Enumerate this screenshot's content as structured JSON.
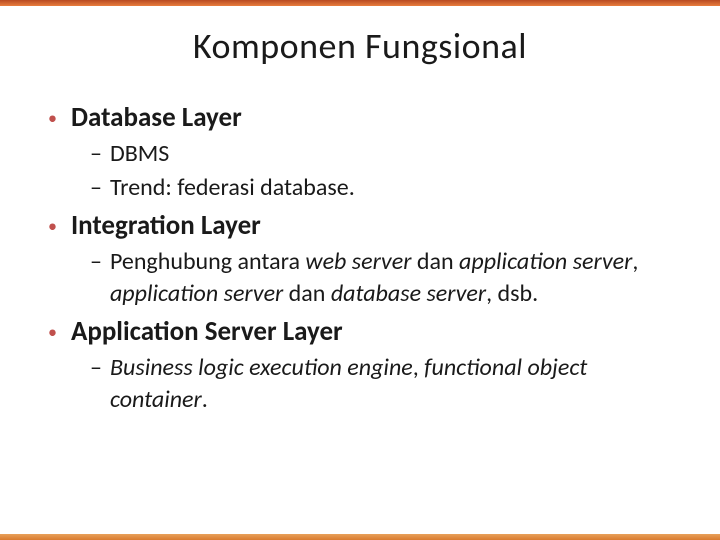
{
  "title": "Komponen Fungsional",
  "items": [
    {
      "label": "Database Layer",
      "sub": [
        {
          "runs": [
            {
              "t": "DBMS"
            }
          ]
        },
        {
          "runs": [
            {
              "t": "Trend: federasi database."
            }
          ]
        }
      ]
    },
    {
      "label": "Integration Layer",
      "sub": [
        {
          "runs": [
            {
              "t": "Penghubung antara "
            },
            {
              "t": "web server",
              "i": true
            },
            {
              "t": " dan "
            },
            {
              "t": "application server",
              "i": true
            },
            {
              "t": ", "
            },
            {
              "t": "application server",
              "i": true
            },
            {
              "t": " dan "
            },
            {
              "t": "database server",
              "i": true
            },
            {
              "t": ", dsb."
            }
          ]
        }
      ]
    },
    {
      "label": "Application Server Layer",
      "sub": [
        {
          "runs": [
            {
              "t": "Business logic execution engine",
              "i": true
            },
            {
              "t": ", "
            },
            {
              "t": "functional object container",
              "i": true
            },
            {
              "t": "."
            }
          ]
        }
      ]
    }
  ]
}
